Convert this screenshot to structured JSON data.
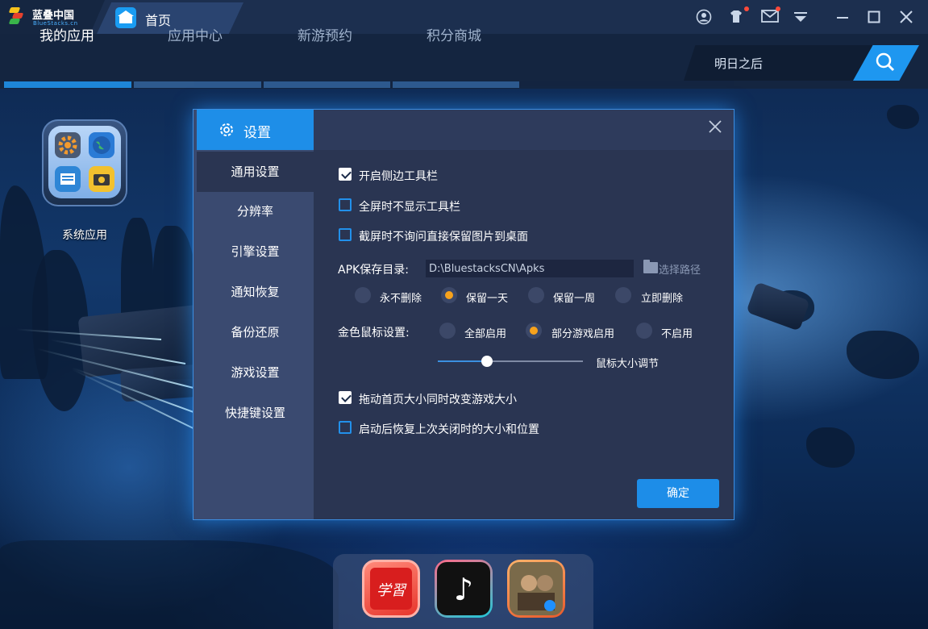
{
  "window": {
    "logo_text": "蓝叠中国",
    "logo_sub": "BlueStacks.cn",
    "home_tab": "首页",
    "icons": [
      "user-icon",
      "shirt-icon",
      "mail-icon",
      "dropdown-icon",
      "minimize-icon",
      "maximize-icon",
      "close-icon"
    ]
  },
  "nav": {
    "tabs": [
      "我的应用",
      "应用中心",
      "新游预约",
      "积分商城"
    ],
    "active": 0,
    "search_value": "明日之后"
  },
  "desktop": {
    "app_label": "系统应用"
  },
  "dialog": {
    "title": "设置",
    "menu": [
      "通用设置",
      "分辨率",
      "引擎设置",
      "通知恢复",
      "备份还原",
      "游戏设置",
      "快捷键设置"
    ],
    "active_menu": 0,
    "options": {
      "show_sidebar": {
        "label": "开启侧边工具栏",
        "checked": true
      },
      "hide_toolbar_fullscreen": {
        "label": "全屏时不显示工具栏",
        "checked": false
      },
      "screenshot_save_desktop": {
        "label": "截屏时不询问直接保留图片到桌面",
        "checked": false
      },
      "resize_game_with_home": {
        "label": "拖动首页大小同时改变游戏大小",
        "checked": true
      },
      "restore_last_size": {
        "label": "启动后恢复上次关闭时的大小和位置",
        "checked": false
      }
    },
    "apk": {
      "label": "APK保存目录:",
      "path": "D:\\BluestacksCN\\Apks",
      "choose": "选择路径",
      "retention": [
        "永不删除",
        "保留一天",
        "保留一周",
        "立即删除"
      ],
      "retention_selected": 1
    },
    "mouse": {
      "label": "金色鼠标设置:",
      "options": [
        "全部启用",
        "部分游戏启用",
        "不启用"
      ],
      "selected": 1,
      "size_label": "鼠标大小调节",
      "size_level": 0.34
    },
    "confirm": "确定"
  },
  "dock": {
    "apps": [
      "学习强国",
      "抖音",
      "和平精英"
    ],
    "app_glyphs": [
      "学習",
      "♪",
      ""
    ]
  }
}
